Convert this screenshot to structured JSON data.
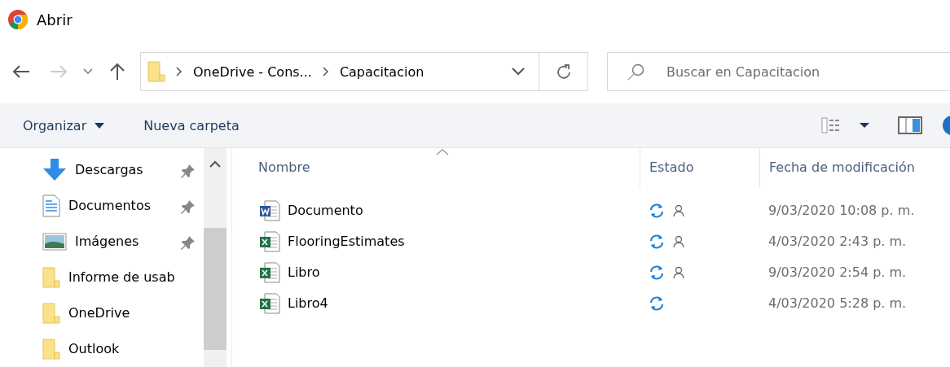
{
  "window": {
    "title": "Abrir"
  },
  "address": {
    "crumbs": [
      "OneDrive - Cons...",
      "Capacitacion"
    ]
  },
  "search": {
    "placeholder": "Buscar en Capacitacion"
  },
  "toolbar": {
    "organize": "Organizar",
    "new_folder": "Nueva carpeta"
  },
  "sidebar": {
    "items": [
      {
        "label": "Descargas",
        "kind": "downloads",
        "pinned": true
      },
      {
        "label": "Documentos",
        "kind": "documents",
        "pinned": true
      },
      {
        "label": "Imágenes",
        "kind": "pictures",
        "pinned": true
      },
      {
        "label": "Informe de usab",
        "kind": "folder",
        "pinned": false
      },
      {
        "label": "OneDrive",
        "kind": "folder",
        "pinned": false
      },
      {
        "label": "Outlook",
        "kind": "folder",
        "pinned": false
      }
    ]
  },
  "table": {
    "columns": [
      "Nombre",
      "Estado",
      "Fecha de modificación"
    ],
    "rows": [
      {
        "name": "Documento",
        "kind": "word",
        "shared": true,
        "date": "9/03/2020 10:08 p. m."
      },
      {
        "name": "FlooringEstimates",
        "kind": "excel",
        "shared": true,
        "date": "4/03/2020 2:43 p. m."
      },
      {
        "name": "Libro",
        "kind": "excel",
        "shared": true,
        "date": "9/03/2020 2:54 p. m."
      },
      {
        "name": "Libro4",
        "kind": "excel",
        "shared": false,
        "date": "4/03/2020 5:28 p. m."
      }
    ]
  }
}
